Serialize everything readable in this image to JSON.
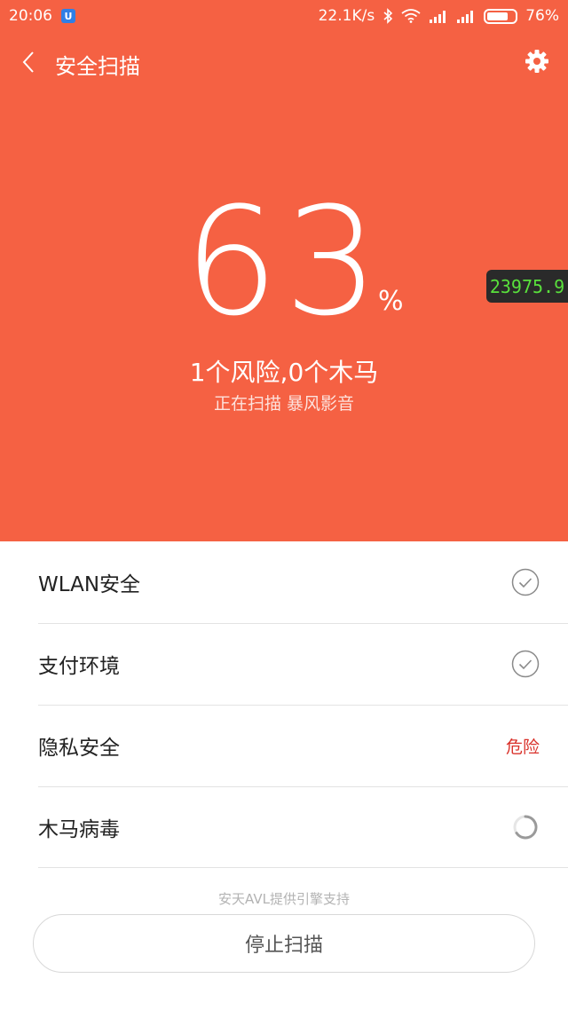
{
  "status_bar": {
    "time": "20:06",
    "net_speed": "22.1K/s",
    "battery_percent": "76%",
    "battery_level": 0.76,
    "icons": [
      "app-notification-icon",
      "bluetooth-icon",
      "wifi-icon",
      "signal-icon",
      "signal-icon",
      "battery-icon"
    ]
  },
  "header": {
    "title": "安全扫描",
    "back_icon": "chevron-left-icon",
    "settings_icon": "gear-icon"
  },
  "scan": {
    "progress_value": "63",
    "percent_sign": "%",
    "summary": "1个风险,0个木马",
    "status_text": "正在扫描 暴风影音"
  },
  "overlay": {
    "counter": "23975.9"
  },
  "items": [
    {
      "label": "WLAN安全",
      "state": "checked",
      "status_text": ""
    },
    {
      "label": "支付环境",
      "state": "checked",
      "status_text": ""
    },
    {
      "label": "隐私安全",
      "state": "danger",
      "status_text": "危险"
    },
    {
      "label": "木马病毒",
      "state": "scanning",
      "status_text": ""
    }
  ],
  "footer": {
    "powered_by": "安天AVL提供引擎支持",
    "stop_button": "停止扫描"
  },
  "colors": {
    "accent": "#f56143",
    "danger": "#d9312a",
    "counter_text": "#59e03c"
  }
}
